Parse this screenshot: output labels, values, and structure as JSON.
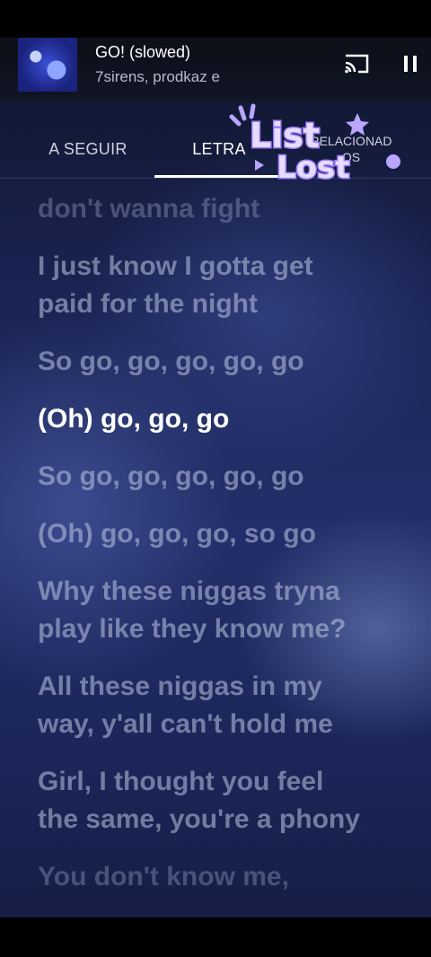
{
  "player": {
    "title": "GO! (slowed)",
    "artist": "7sirens, prodkaz e",
    "cast_icon": "cast-icon",
    "pause_icon": "pause-icon"
  },
  "tabs": {
    "up_next": "A SEGUIR",
    "lyrics": "LETRA",
    "related_line1": "RELACIONAD",
    "related_line2": "OS",
    "selected": "LETRA"
  },
  "watermark": {
    "text_line1": "List",
    "text_line2": "Lost"
  },
  "lyrics": [
    {
      "text": "don't wanna fight",
      "state": "faded"
    },
    {
      "text": "I just know I gotta get",
      "state": "past"
    },
    {
      "text": "paid for the night",
      "state": "past"
    },
    {
      "text": "So go, go, go, go, go",
      "state": "past"
    },
    {
      "text": "(Oh) go, go, go",
      "state": "active"
    },
    {
      "text": "So go, go, go, go, go",
      "state": "upcoming"
    },
    {
      "text": "(Oh) go, go, go, so go",
      "state": "upcoming"
    },
    {
      "text": "Why these niggas tryna",
      "state": "upcoming"
    },
    {
      "text": "play like they know me?",
      "state": "upcoming"
    },
    {
      "text": "All these niggas in my",
      "state": "upcoming"
    },
    {
      "text": "way, y'all can't hold me",
      "state": "upcoming"
    },
    {
      "text": "Girl, I thought you feel",
      "state": "upcoming"
    },
    {
      "text": "the same, you're a phony",
      "state": "upcoming"
    },
    {
      "text": "You don't know me,",
      "state": "upcoming"
    }
  ],
  "colors": {
    "accent": "#ffffff",
    "watermark": "#c9b8ff"
  }
}
